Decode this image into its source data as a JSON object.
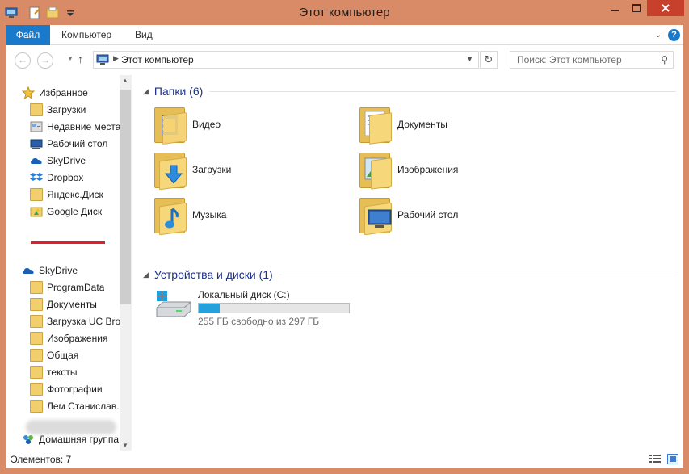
{
  "window": {
    "title": "Этот компьютер",
    "colors": {
      "frame": "#d98a67",
      "accent": "#1979ca",
      "close": "#c7402b"
    }
  },
  "ribbon": {
    "file_tab": "Файл",
    "tabs": [
      "Компьютер",
      "Вид"
    ]
  },
  "address_bar": {
    "crumb": "Этот компьютер",
    "search_placeholder": "Поиск: Этот компьютер"
  },
  "nav": {
    "favorites": {
      "label": "Избранное",
      "items": [
        {
          "label": "Загрузки",
          "icon": "downloads-folder-icon"
        },
        {
          "label": "Недавние места",
          "icon": "recent-places-icon"
        },
        {
          "label": "Рабочий стол",
          "icon": "desktop-icon"
        },
        {
          "label": "SkyDrive",
          "icon": "skydrive-icon"
        },
        {
          "label": "Dropbox",
          "icon": "dropbox-icon"
        },
        {
          "label": "Яндекс.Диск",
          "icon": "folder-icon"
        },
        {
          "label": "Google Диск",
          "icon": "google-drive-icon"
        }
      ]
    },
    "skydrive": {
      "label": "SkyDrive",
      "items": [
        {
          "label": "ProgramData"
        },
        {
          "label": "Документы"
        },
        {
          "label": "Загрузка UC Brow"
        },
        {
          "label": "Изображения"
        },
        {
          "label": "Общая"
        },
        {
          "label": "тексты"
        },
        {
          "label": "Фотографии"
        },
        {
          "label": "Лем Станислав."
        }
      ]
    },
    "homegroup": {
      "label": "Домашняя группа"
    }
  },
  "content": {
    "folders_header": "Папки (6)",
    "folders": [
      {
        "label": "Видео",
        "icon": "video-folder-icon"
      },
      {
        "label": "Документы",
        "icon": "documents-folder-icon"
      },
      {
        "label": "Загрузки",
        "icon": "downloads-folder-icon"
      },
      {
        "label": "Изображения",
        "icon": "pictures-folder-icon"
      },
      {
        "label": "Музыка",
        "icon": "music-folder-icon"
      },
      {
        "label": "Рабочий стол",
        "icon": "desktop-folder-icon"
      }
    ],
    "devices_header": "Устройства и диски (1)",
    "drive": {
      "name": "Локальный диск (C:)",
      "free_text": "255 ГБ свободно из 297 ГБ",
      "used_fraction": 0.14
    }
  },
  "status": {
    "count": "Элементов: 7"
  }
}
